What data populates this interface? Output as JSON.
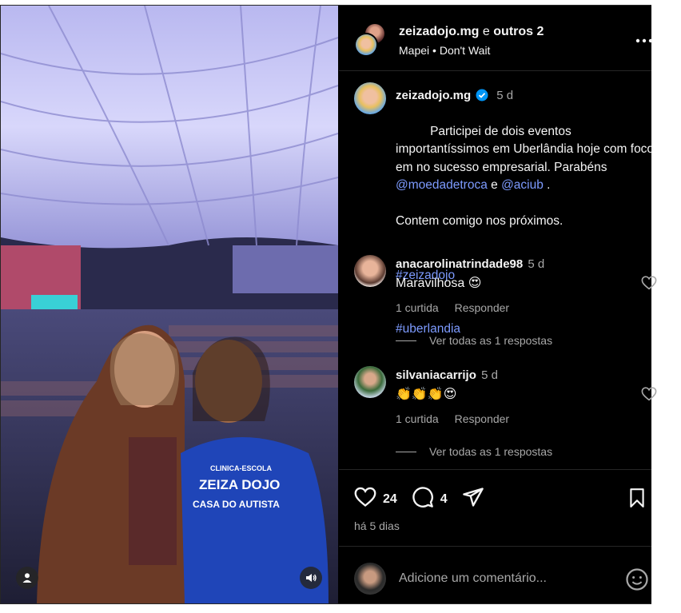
{
  "header": {
    "username": "zeizadojo.mg",
    "joiner": "e",
    "others": "outros 2",
    "music_artist": "Mapei",
    "music_sep": "•",
    "music_song": "Don't Wait"
  },
  "caption": {
    "username": "zeizadojo.mg",
    "time": "5 d",
    "line1": "Participei de dois eventos importantíssimos em Uberlândia hoje com foco em no sucesso empresarial. Parabéns ",
    "mention1": "@moedadetroca",
    "and": " e ",
    "mention2": "@aciub",
    "after": " .",
    "line2": "Contem comigo nos próximos.",
    "hashtag1": "#zeizadojo",
    "hashtag2": "#uberlandia"
  },
  "comments": [
    {
      "username": "anacarolinatrindade98",
      "time": "5 d",
      "text": "Maravilhosa 😍",
      "likes": "1 curtida",
      "reply": "Responder",
      "view_replies": "Ver todas as 1 respostas"
    },
    {
      "username": "silvaniacarrijo",
      "time": "5 d",
      "text": "👏👏👏😍",
      "likes": "1 curtida",
      "reply": "Responder",
      "view_replies": "Ver todas as 1 respostas"
    }
  ],
  "actions": {
    "likes_count": "24",
    "comments_count": "4",
    "posted_ago": "há 5 dias"
  },
  "add_comment": {
    "placeholder": "Adicione um comentário..."
  },
  "media": {
    "shirt_line1": "CLINICA-ESCOLA",
    "shirt_line2": "ZEIZA DOJO",
    "shirt_line3": "CASA DO AUTISTA"
  },
  "colors": {
    "background": "#000000",
    "text": "#f5f5f5",
    "muted": "#a8a8a8",
    "link": "#7d9bff",
    "verified": "#0095f6",
    "divider": "#262626"
  }
}
